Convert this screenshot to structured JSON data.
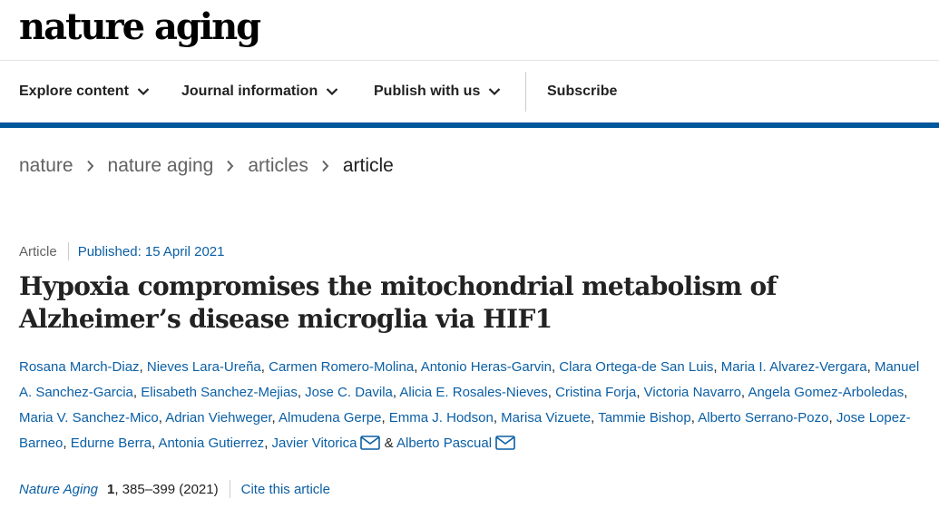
{
  "site": {
    "logo": "nature aging"
  },
  "nav": {
    "explore": "Explore content",
    "journal": "Journal information",
    "publish": "Publish with us",
    "subscribe": "Subscribe"
  },
  "breadcrumbs": [
    "nature",
    "nature aging",
    "articles",
    "article"
  ],
  "article": {
    "type": "Article",
    "published": "Published: 15 April 2021",
    "title": "Hypoxia compromises the mitochondrial metabolism of Alzheimer’s disease microglia via HIF1",
    "authors": [
      "Rosana March-Diaz",
      "Nieves Lara-Ureña",
      "Carmen Romero-Molina",
      "Antonio Heras-Garvin",
      "Clara Ortega-de San Luis",
      "Maria I. Alvarez-Vergara",
      "Manuel A. Sanchez-Garcia",
      "Elisabeth Sanchez-Mejias",
      "Jose C. Davila",
      "Alicia E. Rosales-Nieves",
      "Cristina Forja",
      "Victoria Navarro",
      "Angela Gomez-Arboledas",
      "Maria V. Sanchez-Mico",
      "Adrian Viehweger",
      "Almudena Gerpe",
      "Emma J. Hodson",
      "Marisa Vizuete",
      "Tammie Bishop",
      "Alberto Serrano-Pozo",
      "Jose Lopez-Barneo",
      "Edurne Berra",
      "Antonia Gutierrez",
      "Javier Vitorica",
      "Alberto Pascual"
    ],
    "ampersand": "&",
    "journal": "Nature Aging",
    "volume": "1",
    "pages": ", 385–399 (2021)",
    "cite": "Cite this article"
  },
  "icons": {
    "chevron": "chevron-down-icon",
    "breadcrumb": "chevron-right-icon",
    "mail": "mail-icon"
  },
  "colors": {
    "link": "#0b5fa5",
    "accent_bar": "#01579b",
    "text": "#222222",
    "muted": "#626262"
  }
}
